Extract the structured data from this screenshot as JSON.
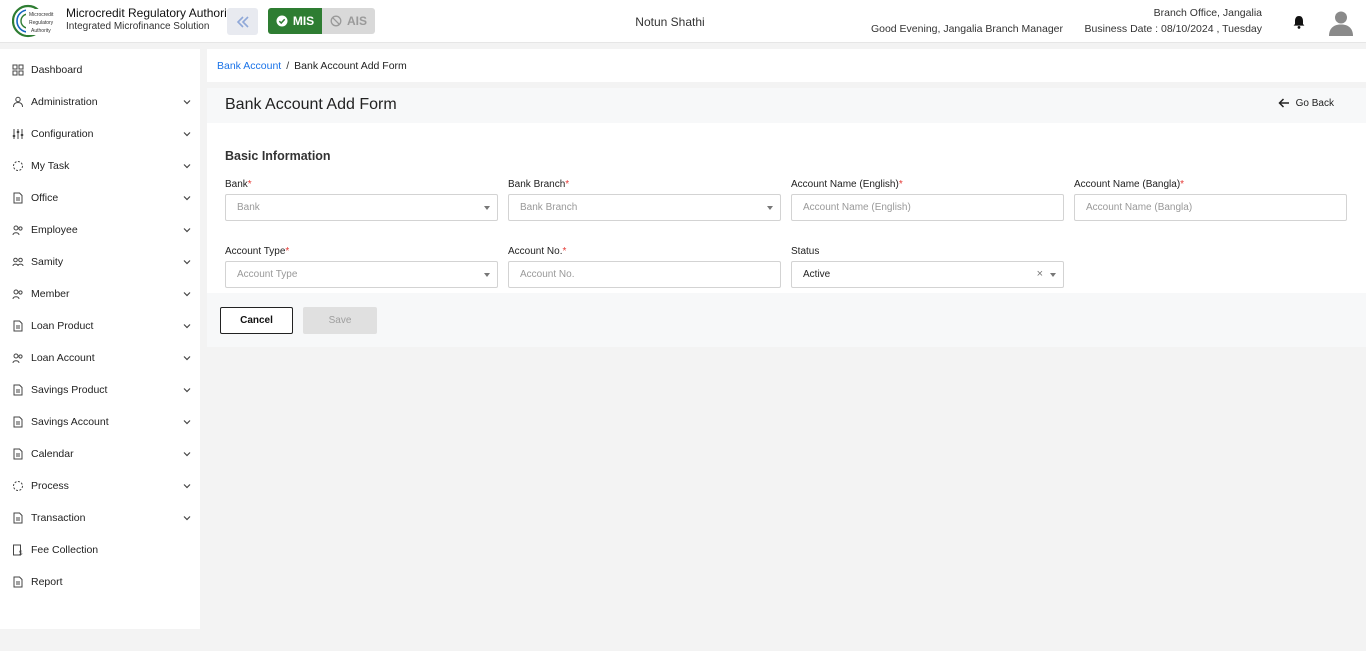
{
  "header": {
    "org_name": "Microcredit Regulatory Authority",
    "org_sub": "Integrated Microfinance Solution",
    "logo_lines": [
      "Microcredit",
      "Regulatory",
      "Authority"
    ],
    "mode_mis": "MIS",
    "mode_ais": "AIS",
    "center_title": "Notun Shathi",
    "greeting": "Good Evening, Jangalia Branch Manager",
    "branch": "Branch Office, Jangalia",
    "business_date": "Business Date : 08/10/2024 , Tuesday"
  },
  "sidebar": {
    "items": [
      {
        "label": "Dashboard",
        "icon": "dashboard-icon",
        "expandable": false
      },
      {
        "label": "Administration",
        "icon": "administration-icon",
        "expandable": true
      },
      {
        "label": "Configuration",
        "icon": "configuration-icon",
        "expandable": true
      },
      {
        "label": "My Task",
        "icon": "task-icon",
        "expandable": true
      },
      {
        "label": "Office",
        "icon": "office-icon",
        "expandable": true
      },
      {
        "label": "Employee",
        "icon": "employee-icon",
        "expandable": true
      },
      {
        "label": "Samity",
        "icon": "samity-icon",
        "expandable": true
      },
      {
        "label": "Member",
        "icon": "member-icon",
        "expandable": true
      },
      {
        "label": "Loan Product",
        "icon": "loan-product-icon",
        "expandable": true
      },
      {
        "label": "Loan Account",
        "icon": "loan-account-icon",
        "expandable": true
      },
      {
        "label": "Savings Product",
        "icon": "savings-product-icon",
        "expandable": true
      },
      {
        "label": "Savings Account",
        "icon": "savings-account-icon",
        "expandable": true
      },
      {
        "label": "Calendar",
        "icon": "calendar-icon",
        "expandable": true
      },
      {
        "label": "Process",
        "icon": "process-icon",
        "expandable": true
      },
      {
        "label": "Transaction",
        "icon": "transaction-icon",
        "expandable": true
      },
      {
        "label": "Fee Collection",
        "icon": "fee-collection-icon",
        "expandable": false
      },
      {
        "label": "Report",
        "icon": "report-icon",
        "expandable": false
      }
    ]
  },
  "breadcrumb": {
    "parent": "Bank Account",
    "separator": "/",
    "current": "Bank Account Add Form"
  },
  "page": {
    "title": "Bank Account Add Form",
    "go_back": "Go Back"
  },
  "form": {
    "section_title": "Basic Information",
    "required_mark": "*",
    "fields": {
      "bank": {
        "label": "Bank",
        "placeholder": "Bank",
        "value": ""
      },
      "bank_branch": {
        "label": "Bank Branch",
        "placeholder": "Bank Branch",
        "value": ""
      },
      "account_name_en": {
        "label": "Account Name (English)",
        "placeholder": "Account Name (English)",
        "value": ""
      },
      "account_name_bn": {
        "label": "Account Name (Bangla)",
        "placeholder": "Account Name (Bangla)",
        "value": ""
      },
      "account_type": {
        "label": "Account Type",
        "placeholder": "Account Type",
        "value": ""
      },
      "account_no": {
        "label": "Account No.",
        "placeholder": "Account No.",
        "value": ""
      },
      "status": {
        "label": "Status",
        "value": "Active",
        "clear": "×"
      }
    },
    "cancel_label": "Cancel",
    "save_label": "Save"
  },
  "colors": {
    "accent_green": "#2e7d32",
    "link_blue": "#1a73e8",
    "required_red": "#e53935"
  }
}
